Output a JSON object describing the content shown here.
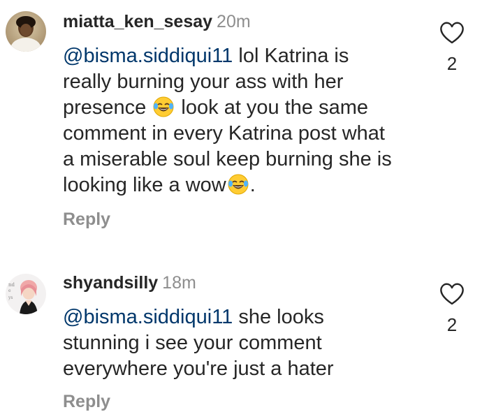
{
  "comments": [
    {
      "username": "miatta_ken_sesay",
      "time": "20m",
      "mention": "@bisma.siddiqui11",
      "lines": [
        " lol Katrina is",
        "really burning your ass with her",
        "presence",
        " look at you the same",
        "comment in every Katrina post what",
        "a miserable soul keep burning she is",
        "looking like a wow",
        "."
      ],
      "emojis": [
        "face-with-tears-of-joy-icon",
        "face-with-tears-of-joy-icon"
      ],
      "reply_label": "Reply",
      "like_count": "2",
      "like_icon": "heart-outline-icon"
    },
    {
      "username": "shyandsilly",
      "time": "18m",
      "mention": "@bisma.siddiqui11",
      "lines": [
        " she looks",
        "stunning i see your comment",
        "everywhere you're just a hater"
      ],
      "reply_label": "Reply",
      "like_count": "2",
      "like_icon": "heart-outline-icon"
    }
  ],
  "colors": {
    "text": "#262626",
    "secondary": "#8e8e8e",
    "mention": "#00376b",
    "background": "#ffffff"
  }
}
